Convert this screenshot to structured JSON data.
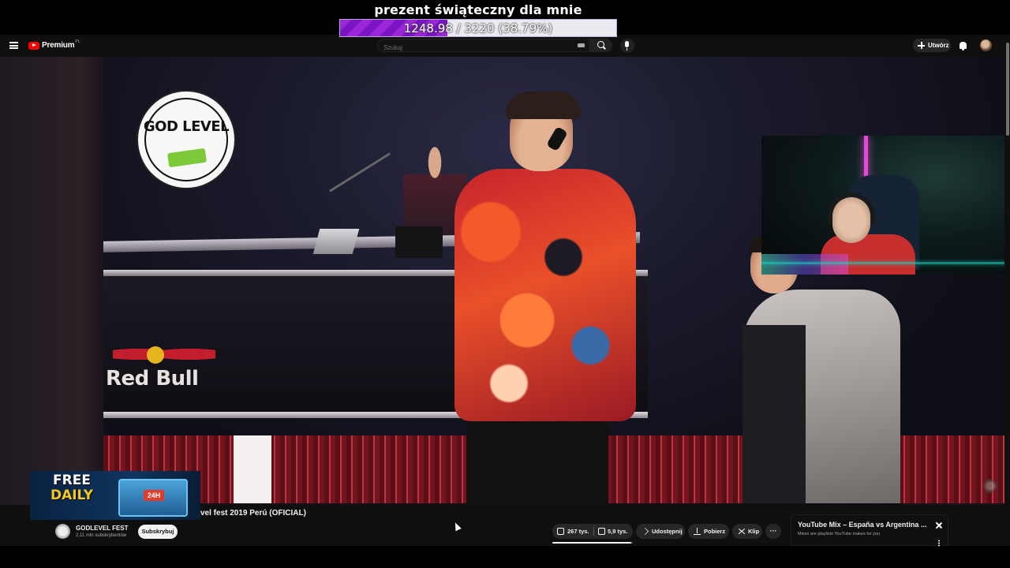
{
  "overlay": {
    "goal_title": "prezent świąteczny dla mnie",
    "goal_text": "1248.98 / 3220 (38.79%)",
    "goal_fraction": 0.3879
  },
  "header": {
    "logo_label": "Premium",
    "logo_region": "PL",
    "search_placeholder": "Szukaj",
    "create_label": "Utwórz"
  },
  "video": {
    "logo_text": "GOD LEVEL",
    "sponsor_text": "Red Bull",
    "title": "vel fest 2019 Perú (OFICIAL)"
  },
  "promo": {
    "line1": "FREE",
    "line2": "DAILY",
    "badge": "24H"
  },
  "channel": {
    "name": "GODLEVEL FEST",
    "subscribers": "2,11 mln subskrybentów",
    "subscribe_label": "Subskrybuj"
  },
  "actions": {
    "likes": "267 tys.",
    "dislikes": "5,9 tys.",
    "share": "Udostępnij",
    "download": "Pobierz",
    "clip": "Klip",
    "more": "···",
    "like_ratio": 0.978
  },
  "mix": {
    "title": "YouTube Mix – España vs Argentina ...",
    "subtitle": "Mixes are playlists YouTube makes for you"
  },
  "colors": {
    "accent_purple": "#9c27d9",
    "yt_red": "#ff0000",
    "background": "#0f0f0f"
  }
}
